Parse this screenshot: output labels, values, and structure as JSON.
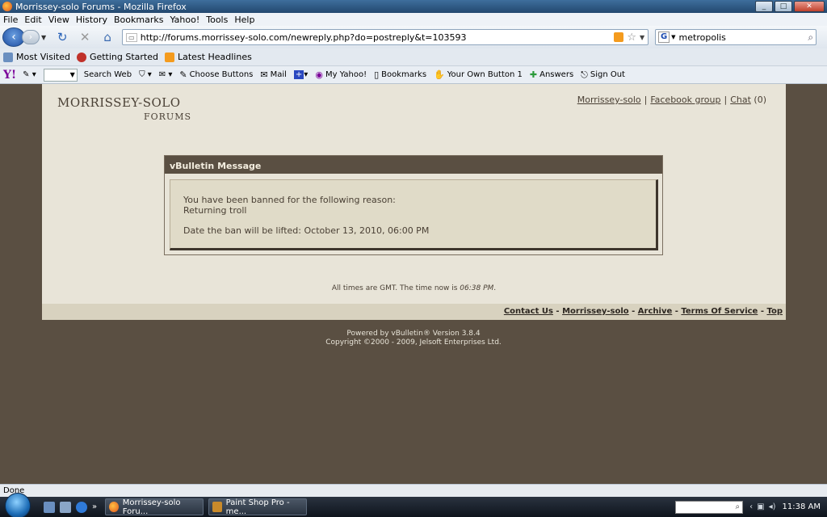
{
  "window": {
    "title": "Morrissey-solo Forums - Mozilla Firefox",
    "controls": {
      "minimize": "_",
      "maximize": "□",
      "close": "✕"
    }
  },
  "menu": [
    "File",
    "Edit",
    "View",
    "History",
    "Bookmarks",
    "Yahoo!",
    "Tools",
    "Help"
  ],
  "navbar": {
    "url": "http://forums.morrissey-solo.com/newreply.php?do=postreply&t=103593",
    "search_value": "metropolis"
  },
  "bookmarks": [
    "Most Visited",
    "Getting Started",
    "Latest Headlines"
  ],
  "yahoo_toolbar": {
    "logo": "Y!",
    "items": [
      "Search Web",
      "Choose Buttons",
      "Mail",
      "My Yahoo!",
      "Bookmarks",
      "Your Own Button 1",
      "Answers",
      "Sign Out"
    ]
  },
  "page": {
    "logo_line1": "MORRISSEY-SOLO",
    "logo_line2": "FORUMS",
    "top_links": [
      "Morrissey-solo",
      "Facebook group",
      "Chat"
    ],
    "chat_count": "(0)",
    "message": {
      "header": "vBulletin Message",
      "line1": "You have been banned for the following reason:",
      "line2": "Returning troll",
      "line3": "Date the ban will be lifted: October 13, 2010, 06:00 PM"
    },
    "time_prefix": "All times are GMT. The time now is ",
    "time_value": "06:38 PM",
    "time_suffix": ".",
    "footer_links": [
      "Contact Us",
      "Morrissey-solo",
      "Archive",
      "Terms Of Service",
      "Top"
    ],
    "powered_line1": "Powered by vBulletin® Version 3.8.4",
    "powered_line2": "Copyright ©2000 - 2009, Jelsoft Enterprises Ltd."
  },
  "status": "Done",
  "taskbar": {
    "tasks": [
      "Morrissey-solo Foru...",
      "Paint Shop Pro - me..."
    ],
    "clock": "11:38 AM",
    "overflow_glyph": "»"
  },
  "colors": {
    "background": "#5a4f42",
    "page": "#e8e4d8",
    "accent": "#5a4f42",
    "text": "#4a4035"
  }
}
